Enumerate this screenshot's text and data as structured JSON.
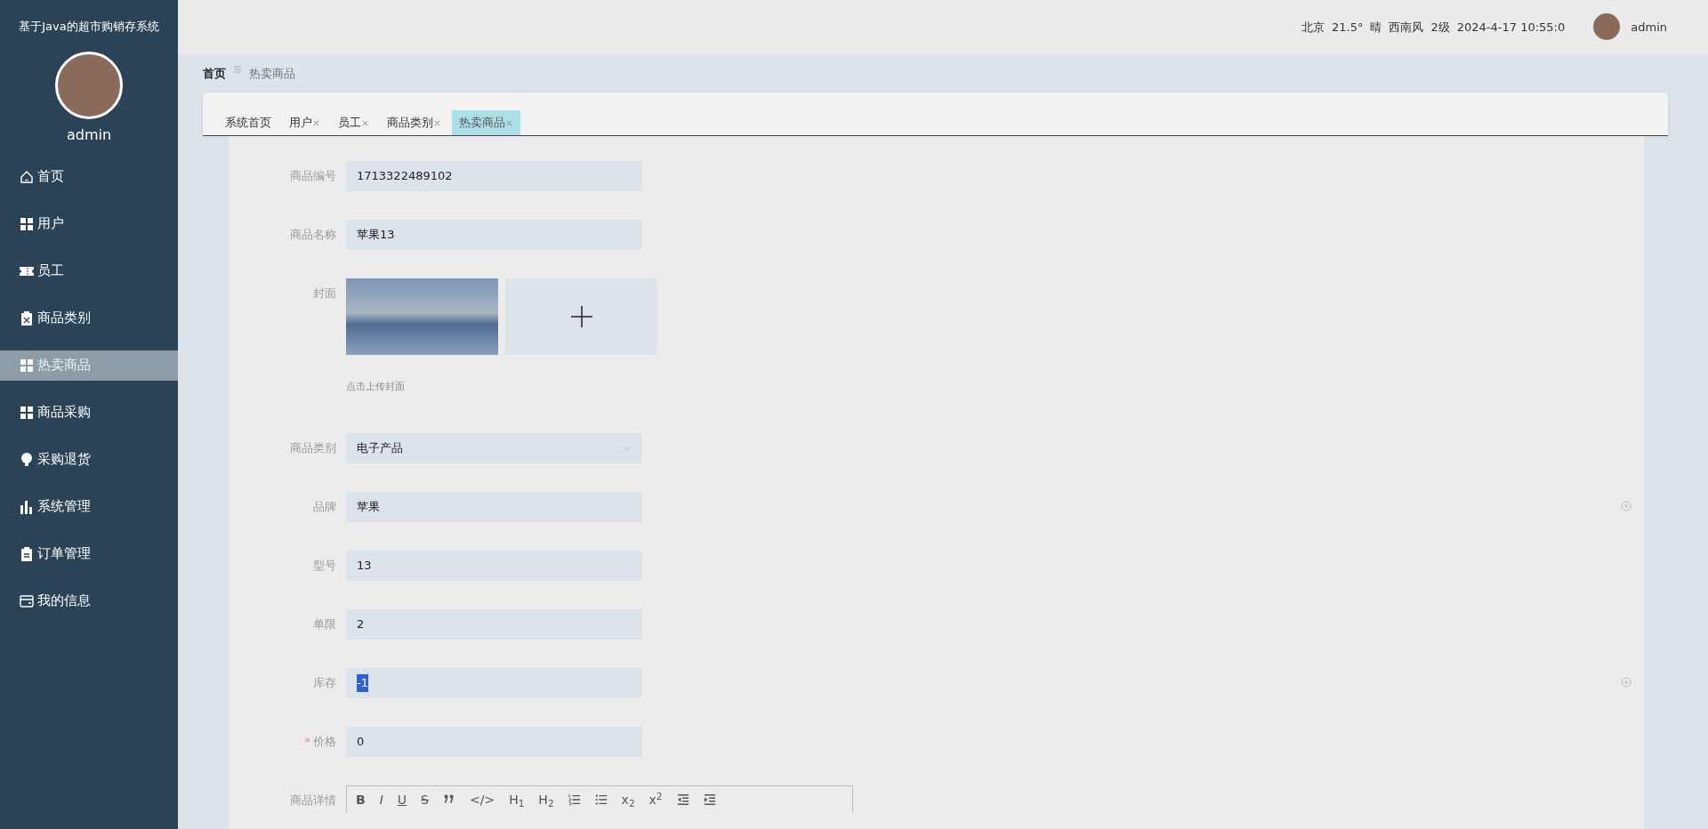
{
  "sidebar": {
    "title": "基于Java的超市购销存系统",
    "user": "admin",
    "items": [
      {
        "label": "首页",
        "selected": false
      },
      {
        "label": "用户",
        "selected": false
      },
      {
        "label": "员工",
        "selected": false
      },
      {
        "label": "商品类别",
        "selected": false
      },
      {
        "label": "热卖商品",
        "selected": true
      },
      {
        "label": "商品采购",
        "selected": false
      },
      {
        "label": "采购退货",
        "selected": false
      },
      {
        "label": "系统管理",
        "selected": false
      },
      {
        "label": "订单管理",
        "selected": false
      },
      {
        "label": "我的信息",
        "selected": false
      }
    ]
  },
  "header": {
    "weather": [
      "北京",
      "21.5°",
      "晴",
      "西南风",
      "2级",
      "2024-4-17 10:55:0"
    ],
    "user": "admin"
  },
  "breadcrumb": [
    "首页",
    "热卖商品"
  ],
  "tabs": [
    {
      "label": "系统首页",
      "closable": false,
      "selected": false
    },
    {
      "label": "用户",
      "closable": true,
      "selected": false
    },
    {
      "label": "员工",
      "closable": true,
      "selected": false
    },
    {
      "label": "商品类别",
      "closable": true,
      "selected": false
    },
    {
      "label": "热卖商品",
      "closable": true,
      "selected": true
    }
  ],
  "form": [
    {
      "kind": "text",
      "label": "商品编号",
      "value": "1713322489102",
      "clearable": false,
      "text_selected": false
    },
    {
      "kind": "text",
      "label": "商品名称",
      "value": "苹果13",
      "clearable": false,
      "text_selected": false
    },
    {
      "kind": "upload",
      "label": "封面",
      "hint": "点击上传封面"
    },
    {
      "kind": "select",
      "label": "商品类别",
      "value": "电子产品"
    },
    {
      "kind": "text",
      "label": "品牌",
      "value": "苹果",
      "clearable": true,
      "text_selected": false
    },
    {
      "kind": "text",
      "label": "型号",
      "value": "13",
      "clearable": false,
      "text_selected": false
    },
    {
      "kind": "text",
      "label": "单限",
      "value": "2",
      "clearable": false,
      "text_selected": false
    },
    {
      "kind": "text",
      "label": "库存",
      "value": "-1",
      "clearable": true,
      "text_selected": true
    },
    {
      "kind": "text",
      "label": "价格",
      "required_mark": "*",
      "value": "0",
      "clearable": false,
      "text_selected": false
    },
    {
      "kind": "editor",
      "label": "商品详情",
      "toolbar": [
        {
          "kind": "bold",
          "text": "B"
        },
        {
          "kind": "italic",
          "text": "I"
        },
        {
          "kind": "underline",
          "text": "U"
        },
        {
          "kind": "strike",
          "text": "S"
        },
        {
          "kind": "quote"
        },
        {
          "kind": "plain",
          "text": "</>"
        },
        {
          "kind": "plain",
          "text": "H$_{1}$"
        },
        {
          "kind": "plain",
          "text": "H$_{2}$"
        },
        {
          "kind": "ol"
        },
        {
          "kind": "ul"
        },
        {
          "kind": "plain",
          "text": "x$_{2}$"
        },
        {
          "kind": "plain",
          "text": "x$^{2}$"
        },
        {
          "kind": "outdent"
        },
        {
          "kind": "indent"
        }
      ]
    }
  ]
}
